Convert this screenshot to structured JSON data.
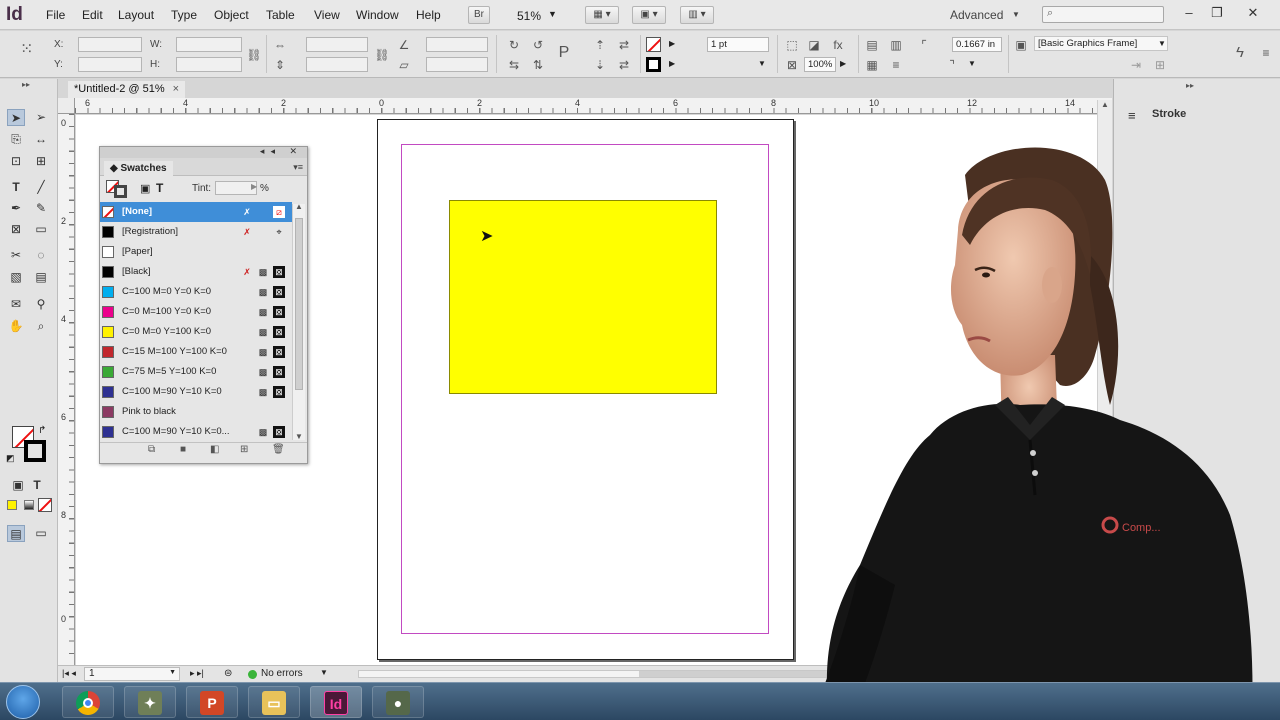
{
  "app": {
    "logo": "Id",
    "menu": [
      "File",
      "Edit",
      "Layout",
      "Type",
      "Object",
      "Table",
      "View",
      "Window",
      "Help"
    ],
    "bridge_label": "Br",
    "zoom": "51%",
    "workspace": "Advanced",
    "window_controls": [
      "‒",
      "❐",
      "✕"
    ]
  },
  "control": {
    "x_label": "X:",
    "y_label": "Y:",
    "w_label": "W:",
    "h_label": "H:",
    "stroke_weight": "1 pt",
    "scale_pct": "100%",
    "offset_value": "0.1667 in",
    "object_style": "[Basic Graphics Frame]"
  },
  "document": {
    "tab_title": "*Untitled-2 @ 51%",
    "tab_close": "×"
  },
  "ruler": {
    "h_ticks": [
      "6",
      "4",
      "2",
      "0",
      "2",
      "4",
      "6",
      "8",
      "10",
      "12",
      "14"
    ],
    "v_ticks": [
      "0",
      "2",
      "4",
      "6",
      "8",
      "0"
    ]
  },
  "right_panel": {
    "stroke_label": "Stroke"
  },
  "status": {
    "page": "1",
    "errors": "No errors"
  },
  "swatches": {
    "title": "Swatches",
    "tint_label": "Tint:",
    "tint_unit": "%",
    "items": [
      {
        "name": "[None]",
        "color": "none",
        "selected": true
      },
      {
        "name": "[Registration]",
        "color": "#000000"
      },
      {
        "name": "[Paper]",
        "color": "#ffffff"
      },
      {
        "name": "[Black]",
        "color": "#000000"
      },
      {
        "name": "C=100 M=0 Y=0 K=0",
        "color": "#00aeef"
      },
      {
        "name": "C=0 M=100 Y=0 K=0",
        "color": "#ec008c"
      },
      {
        "name": "C=0 M=0 Y=100 K=0",
        "color": "#fff200"
      },
      {
        "name": "C=15 M=100 Y=100 K=0",
        "color": "#c1272d"
      },
      {
        "name": "C=75 M=5 Y=100 K=0",
        "color": "#3aa935"
      },
      {
        "name": "C=100 M=90 Y=10 K=0",
        "color": "#2e3192"
      },
      {
        "name": "Pink to black",
        "color": "#8b3a62"
      },
      {
        "name": "C=100 M=90 Y=10 K=0...",
        "color": "#2e3192"
      }
    ]
  },
  "canvas": {
    "frame_color": "#ffff00",
    "margin_color": "#c24ac2"
  },
  "presenter_logo": "Comp..."
}
